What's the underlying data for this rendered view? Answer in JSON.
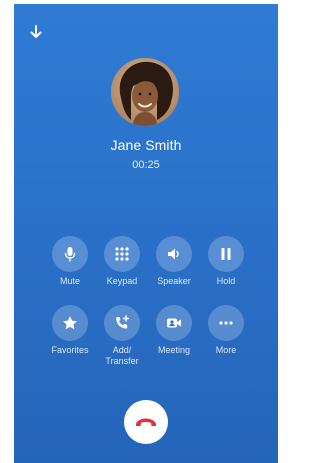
{
  "call": {
    "caller_name": "Jane Smith",
    "timer": "00:25"
  },
  "controls": {
    "mute": "Mute",
    "keypad": "Keypad",
    "speaker": "Speaker",
    "hold": "Hold",
    "favorites": "Favorites",
    "add_transfer": "Add/\nTransfer",
    "meeting": "Meeting",
    "more": "More"
  },
  "icons": {
    "collapse": "arrow-down-icon",
    "mute": "microphone-icon",
    "keypad": "keypad-icon",
    "speaker": "speaker-icon",
    "hold": "pause-icon",
    "favorites": "star-icon",
    "add_transfer": "phone-add-icon",
    "meeting": "video-camera-icon",
    "more": "more-dots-icon",
    "end_call": "hang-up-icon"
  },
  "colors": {
    "background": "#2a6fc7",
    "end_call_icon": "#e0343a",
    "button_fill": "rgba(255,255,255,0.22)"
  }
}
